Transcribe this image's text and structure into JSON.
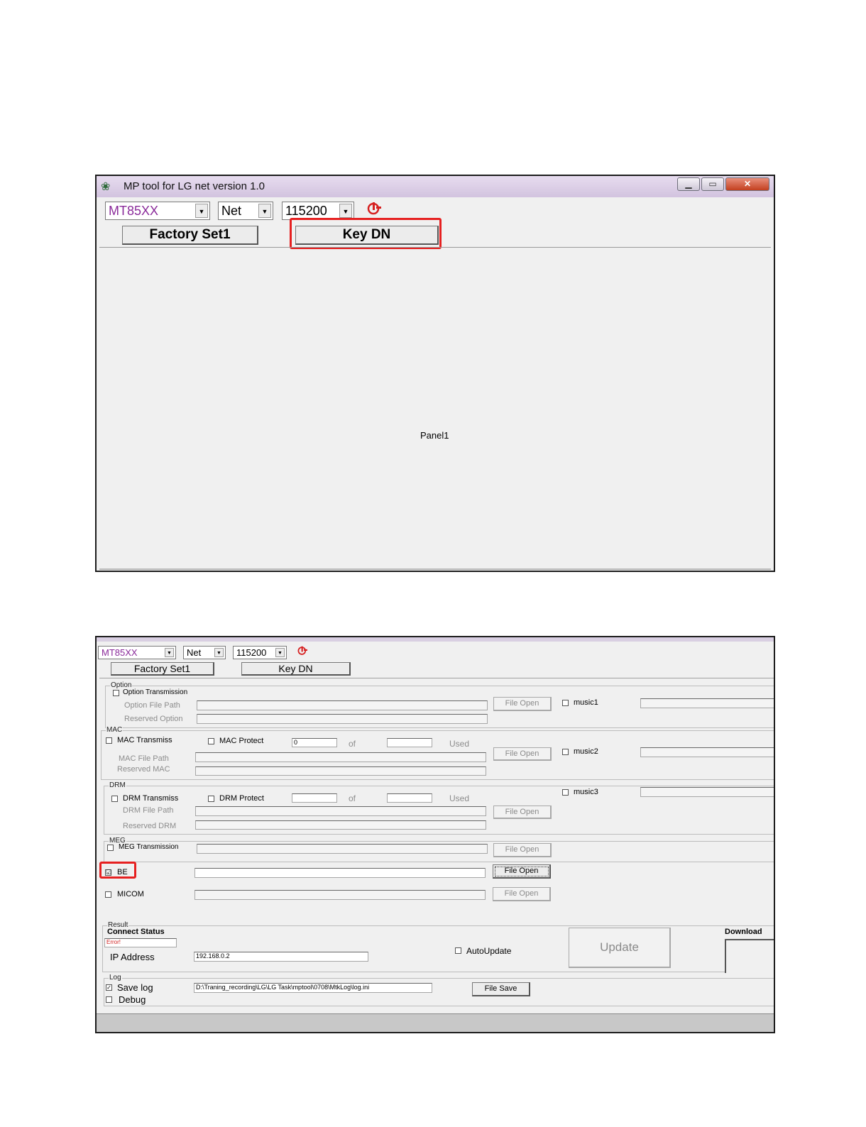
{
  "top_window": {
    "title": "MP tool for LG net version 1.0",
    "window_buttons": {
      "minimize": "▁",
      "maximize": "▭",
      "close": "✕"
    },
    "chip_select": "MT85XX",
    "mode_select": "Net",
    "baud_select": "115200",
    "factory_button": "Factory Set1",
    "key_button": "Key DN",
    "panel_label": "Panel1"
  },
  "bottom_window": {
    "chip_select": "MT85XX",
    "mode_select": "Net",
    "baud_select": "115200",
    "factory_button": "Factory Set1",
    "key_button": "Key DN",
    "option": {
      "label": "Option",
      "transmission": "Option Transmission",
      "file_path": "Option File Path",
      "reserved": "Reserved Option",
      "file_open": "File Open"
    },
    "music": {
      "music1": "music1",
      "music2": "music2",
      "music3": "music3"
    },
    "mac": {
      "label": "MAC",
      "transmission": "MAC Transmiss",
      "protect": "MAC Protect",
      "count_value": "0",
      "of": "of",
      "used": "Used",
      "file_path": "MAC File Path",
      "reserved": "Reserved MAC",
      "file_open": "File Open"
    },
    "drm": {
      "label": "DRM",
      "transmission": "DRM Transmiss",
      "protect": "DRM Protect",
      "of": "of",
      "used": "Used",
      "file_path": "DRM File Path",
      "reserved": "Reserved DRM",
      "file_open": "File Open"
    },
    "meg": {
      "label": "MEG",
      "transmission": "MEG Transmission",
      "file_open": "File Open"
    },
    "be": {
      "label": "BE",
      "checked": "☑",
      "file_open": "File Open"
    },
    "micom": {
      "label": "MICOM",
      "file_open": "File Open"
    },
    "result": {
      "label": "Result",
      "connect_status": "Connect Status",
      "status_value": "Error!",
      "ip_label": "IP Address",
      "ip_value": "192.168.0.2",
      "autoupdate": "AutoUpdate",
      "update_button": "Update",
      "download": "Download"
    },
    "log": {
      "label": "Log",
      "save_log": "Save log",
      "debug": "Debug",
      "log_path": "D:\\Traning_recording\\LG\\LG Task\\mptool\\0708\\MtkLog\\log.ini",
      "file_save": "File Save"
    }
  },
  "colors": {
    "highlight": "#e62020",
    "chip_text": "#8a2a9a",
    "status_error": "#d02020"
  }
}
